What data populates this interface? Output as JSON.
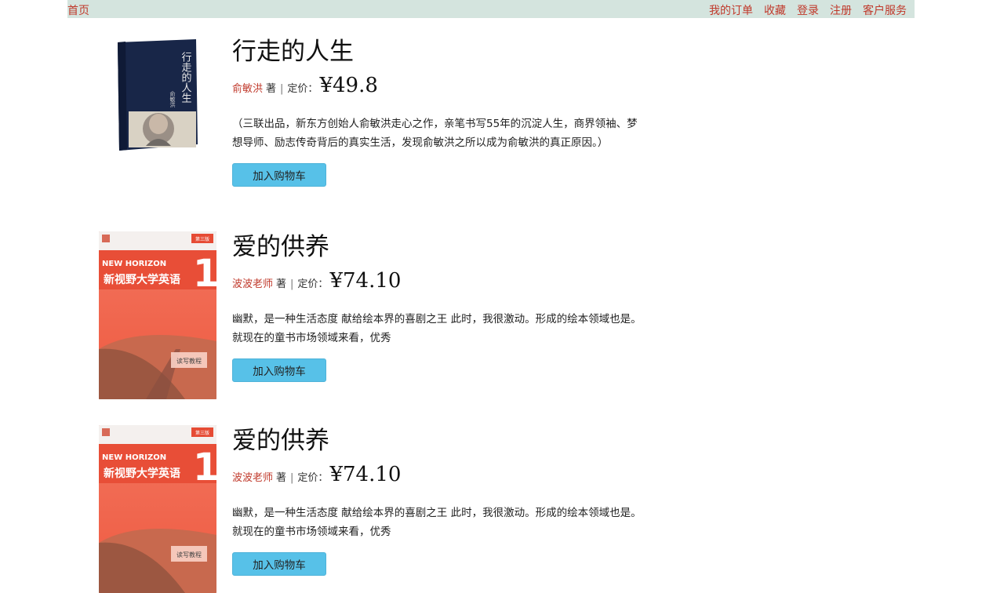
{
  "nav": {
    "home": "首页",
    "links": [
      "我的订单",
      "收藏",
      "登录",
      "注册",
      "客户服务"
    ]
  },
  "books": [
    {
      "title": "行走的人生",
      "author": "俞敏洪",
      "role": "著",
      "price_label": "定价：",
      "price": "¥49.8",
      "description": "（三联出品，新东方创始人俞敏洪走心之作，亲笔书写55年的沉淀人生，商界领袖、梦想导师、励志传奇背后的真实生活，发现俞敏洪之所以成为俞敏洪的真正原因。）",
      "button": "加入购物车",
      "cover_text": [
        "行走的人生",
        "俞敏洪"
      ]
    },
    {
      "title": "爱的供养",
      "author": "波波老师",
      "role": "著",
      "price_label": "定价：",
      "price": "¥74.10",
      "description": "幽默，是一种生活态度 献给绘本界的喜剧之王 此时，我很激动。形成的绘本领域也是。 就现在的童书市场领域来看，优秀",
      "button": "加入购物车",
      "cover_text": [
        "NEW HORIZON",
        "新视野大学英语",
        "读写教程",
        "第三版",
        "1"
      ]
    },
    {
      "title": "爱的供养",
      "author": "波波老师",
      "role": "著",
      "price_label": "定价：",
      "price": "¥74.10",
      "description": "幽默，是一种生活态度 献给绘本界的喜剧之王 此时，我很激动。形成的绘本领域也是。 就现在的童书市场领域来看，优秀",
      "button": "加入购物车",
      "cover_text": [
        "NEW HORIZON",
        "新视野大学英语",
        "读写教程",
        "第三版",
        "1"
      ]
    }
  ]
}
